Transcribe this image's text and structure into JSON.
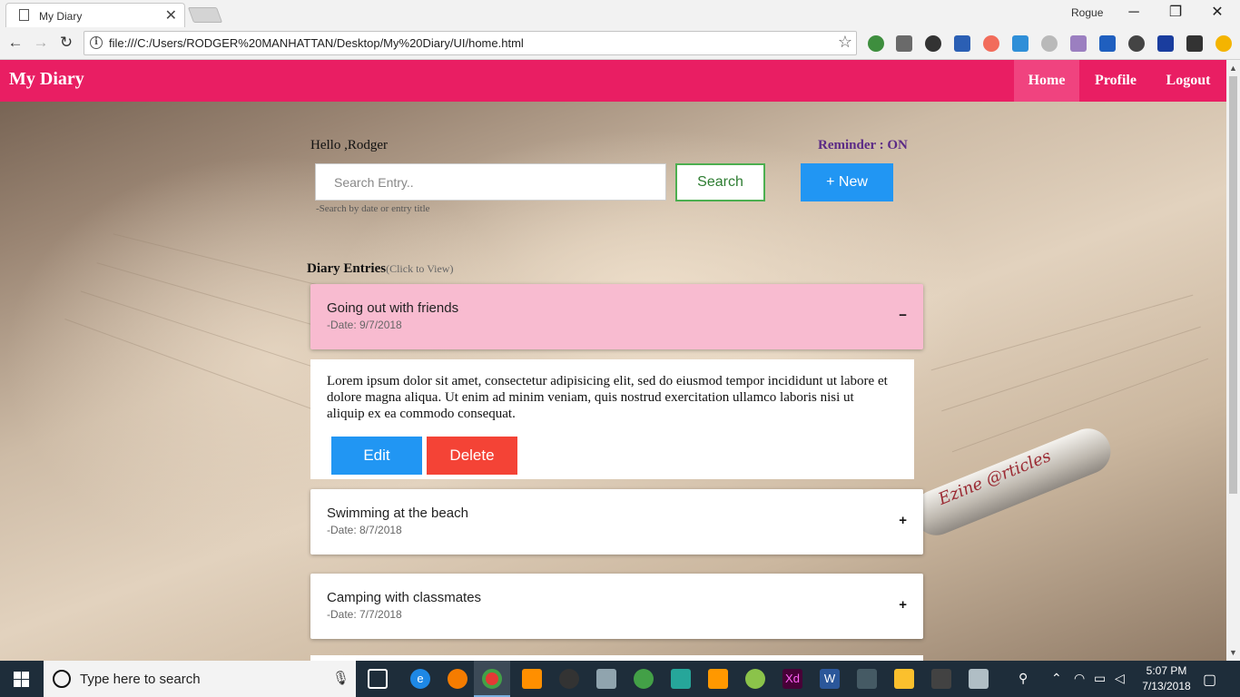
{
  "browser": {
    "tab_title": "My Diary",
    "tab_close": "✕",
    "user_name": "Rogue",
    "minimize": "─",
    "restore": "❐",
    "close": "✕",
    "back": "←",
    "forward": "→",
    "reload": "↻",
    "url": "file:///C:/Users/RODGER%20MANHATTAN/Desktop/My%20Diary/UI/home.html",
    "star": "☆"
  },
  "app": {
    "brand": "My Diary",
    "nav": {
      "home": "Home",
      "profile": "Profile",
      "logout": "Logout"
    },
    "greeting": "Hello ,Rodger",
    "reminder": "Reminder : ON",
    "search_placeholder": "Search Entry..",
    "search_button": "Search",
    "new_button": "+ New",
    "search_hint": "-Search by date or entry title",
    "entries_title": "Diary Entries",
    "entries_subtitle": "(Click to View)",
    "accent_color": "#e91e63",
    "entries": [
      {
        "title": "Going out with friends",
        "date": "-Date: 9/7/2018",
        "toggle": "−",
        "open": true
      },
      {
        "title": "Swimming at the beach",
        "date": "-Date: 8/7/2018",
        "toggle": "+",
        "open": false
      },
      {
        "title": "Camping with classmates",
        "date": "-Date: 7/7/2018",
        "toggle": "+",
        "open": false
      }
    ],
    "open_entry_text": "Lorem ipsum dolor sit amet, consectetur adipisicing elit, sed do eiusmod tempor incididunt ut labore et dolore magna aliqua. Ut enim ad minim veniam, quis nostrud exercitation ullamco laboris nisi ut aliquip ex ea commodo consequat.",
    "edit_button": "Edit",
    "delete_button": "Delete",
    "background_pen_text": "Ezine @rticles"
  },
  "taskbar": {
    "search_text": "Type here to search",
    "time": "5:07 PM",
    "date": "7/13/2018"
  }
}
